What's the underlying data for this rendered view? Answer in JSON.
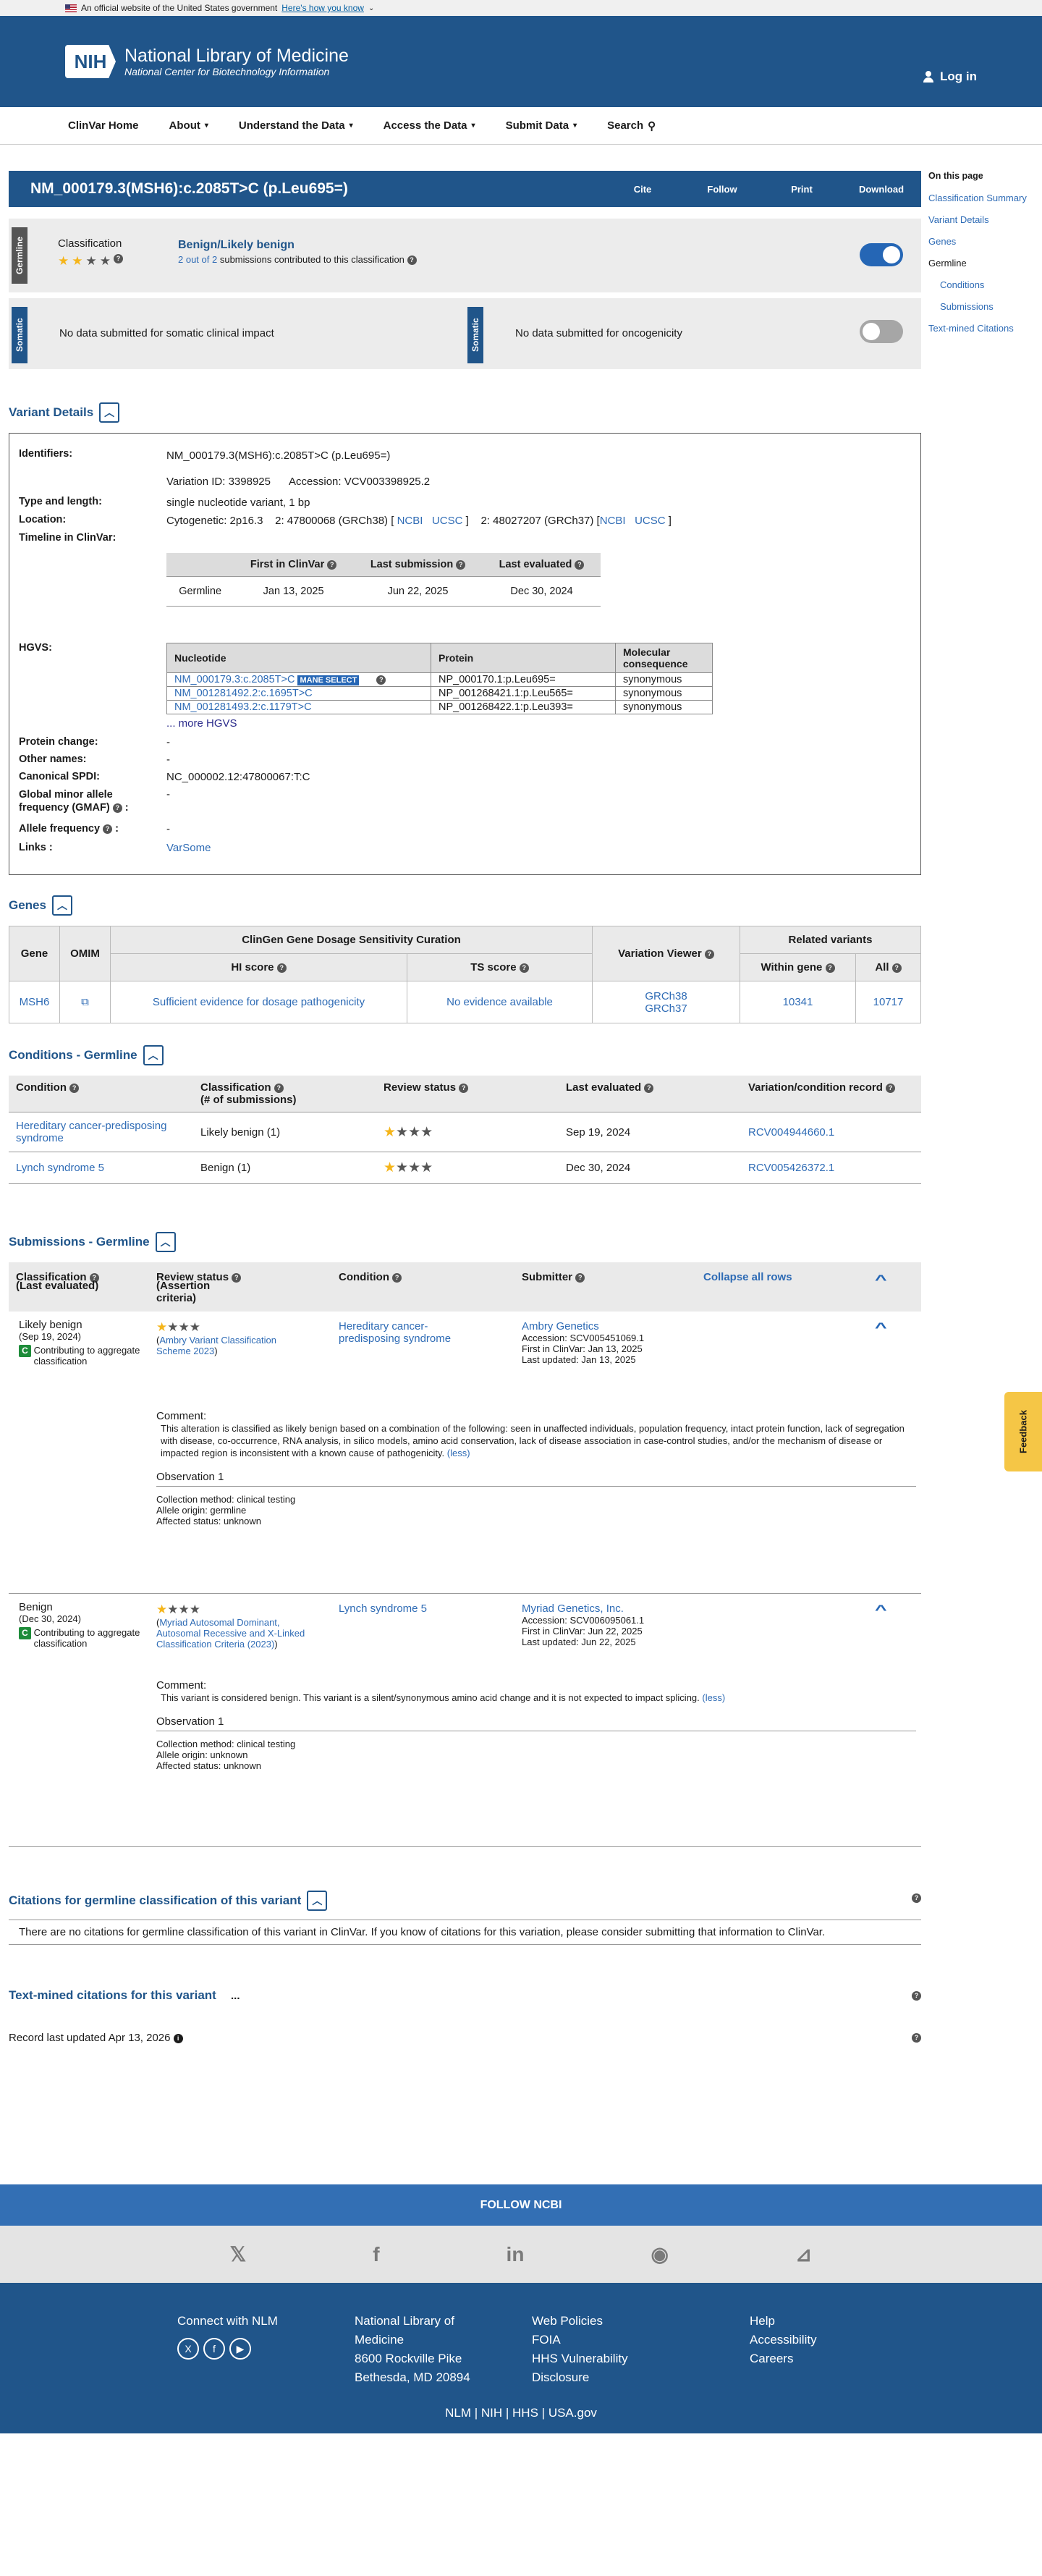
{
  "gov": {
    "text": "An official website of the United States government",
    "how": "Here's how you know"
  },
  "header": {
    "logo": "NIH",
    "title": "National Library of Medicine",
    "subtitle": "National Center for Biotechnology Information",
    "login": "Log in"
  },
  "nav": [
    "ClinVar Home",
    "About",
    "Understand the Data",
    "Access the Data",
    "Submit Data",
    "Search"
  ],
  "title_bar": {
    "title": "NM_000179.3(MSH6):c.2085T>C (p.Leu695=)",
    "cite": "Cite",
    "follow": "Follow",
    "print": "Print",
    "download": "Download"
  },
  "germline": {
    "tab": "Germline",
    "class_label": "Classification",
    "result": "Benign/Likely benign",
    "subm_count": "2 out of 2",
    "subm_rest": "submissions contributed to this classification"
  },
  "somatic": {
    "tab": "Somatic",
    "clinical": "No data submitted for somatic clinical impact",
    "onco": "No data submitted for oncogenicity"
  },
  "side": {
    "head": "On this page",
    "items": [
      "Classification Summary",
      "Variant Details",
      "Genes",
      "Germline",
      "Conditions",
      "Submissions",
      "Text-mined Citations"
    ]
  },
  "vd": {
    "head": "Variant Details",
    "labels": {
      "ident": "Identifiers:",
      "type": "Type and length:",
      "loc": "Location:",
      "timeline": "Timeline in ClinVar:",
      "hgvs": "HGVS:",
      "protein": "Protein change:",
      "other": "Other names:",
      "spdi": "Canonical SPDI:",
      "gmaf1": "Global minor allele",
      "gmaf2": "frequency (GMAF)",
      "af": "Allele frequency",
      "links": "Links :"
    },
    "ident": "NM_000179.3(MSH6):c.2085T>C (p.Leu695=)",
    "varid": "Variation ID: 3398925",
    "acc": "Accession: VCV003398925.2",
    "type": "single nucleotide variant, 1 bp",
    "cyto": "Cytogenetic: 2p16.3",
    "loc38": "2: 47800068 (GRCh38) [",
    "loc37": "2: 48027207 (GRCh37) [",
    "ncbi": "NCBI",
    "ucsc": "UCSC",
    "close": "]",
    "tl_head": [
      "First in ClinVar",
      "Last submission",
      "Last evaluated"
    ],
    "tl_row": [
      "Germline",
      "Jan 13, 2025",
      "Jun 22, 2025",
      "Dec 30, 2024"
    ],
    "hgvs_head": [
      "Nucleotide",
      "Protein",
      "Molecular consequence"
    ],
    "hgvs_rows": [
      [
        "NM_000179.3:c.2085T>C",
        "NP_000170.1:p.Leu695=",
        "synonymous"
      ],
      [
        "NM_001281492.2:c.1695T>C",
        "NP_001268421.1:p.Leu565=",
        "synonymous"
      ],
      [
        "NM_001281493.2:c.1179T>C",
        "NP_001268422.1:p.Leu393=",
        "synonymous"
      ]
    ],
    "mane": "MANE SELECT",
    "more": "... more HGVS",
    "protein": "-",
    "other": "-",
    "spdi": "NC_000002.12:47800067:T:C",
    "gmaf": "-",
    "af": "-",
    "links": "VarSome"
  },
  "genes": {
    "head": "Genes",
    "cols": [
      "Gene",
      "OMIM",
      "ClinGen Gene Dosage Sensitivity Curation",
      "HI score",
      "TS score",
      "Variation Viewer",
      "Related variants",
      "Within gene",
      "All"
    ],
    "row": {
      "gene": "MSH6",
      "hi": "Sufficient evidence for dosage pathogenicity",
      "ts": "No evidence available",
      "v1": "GRCh38",
      "v2": "GRCh37",
      "within": "10341",
      "all": "10717"
    }
  },
  "cond": {
    "head": "Conditions - Germline",
    "cols": [
      "Condition",
      "Classification",
      "(# of submissions)",
      "Review status",
      "Last evaluated",
      "Variation/condition record"
    ],
    "rows": [
      {
        "cond": "Hereditary cancer-predisposing syndrome",
        "cls": "Likely benign (1)",
        "date": "Sep 19, 2024",
        "rcv": "RCV004944660.1"
      },
      {
        "cond": "Lynch syndrome 5",
        "cls": "Benign (1)",
        "date": "Dec 30, 2024",
        "rcv": "RCV005426372.1"
      }
    ]
  },
  "subs": {
    "head": "Submissions - Germline",
    "cols": [
      "Classification",
      "(Last evaluated)",
      "Review status",
      "(Assertion criteria)",
      "Condition",
      "Submitter",
      "Collapse all rows"
    ],
    "s1": {
      "cls": "Likely benign",
      "date": "(Sep 19, 2024)",
      "contrib": "Contributing to aggregate classification",
      "crit": "Ambry Variant Classification Scheme 2023",
      "cond": "Hereditary cancer-predisposing syndrome",
      "sub": "Ambry Genetics",
      "acc": "Accession: SCV005451069.1",
      "first": "First in ClinVar: Jan 13, 2025",
      "upd": "Last updated: Jan 13, 2025",
      "comment_h": "Comment:",
      "comment": "This alteration is classified as likely benign based on a combination of the following: seen in unaffected individuals, population frequency, intact protein function, lack of segregation with disease, co-occurrence, RNA analysis, in silico models, amino acid conservation, lack of disease association in case-control studies, and/or the mechanism of disease or impacted region is inconsistent with a known cause of pathogenicity.",
      "less": "(less)",
      "obs": "Observation 1",
      "m": "Collection method: clinical testing",
      "o": "Allele origin: germline",
      "a": "Affected status: unknown"
    },
    "s2": {
      "cls": "Benign",
      "date": "(Dec 30, 2024)",
      "contrib": "Contributing to aggregate classification",
      "crit": "Myriad Autosomal Dominant, Autosomal Recessive and X-Linked Classification Criteria (2023)",
      "cond": "Lynch syndrome 5",
      "sub": "Myriad Genetics, Inc.",
      "acc": "Accession: SCV006095061.1",
      "first": "First in ClinVar: Jun 22, 2025",
      "upd": "Last updated: Jun 22, 2025",
      "comment_h": "Comment:",
      "comment": "This variant is considered benign. This variant is a silent/synonymous amino acid change and it is not expected to impact splicing.",
      "less": "(less)",
      "obs": "Observation 1",
      "m": "Collection method: clinical testing",
      "o": "Allele origin: unknown",
      "a": "Affected status: unknown"
    }
  },
  "cit": {
    "head": "Citations for germline classification of this variant",
    "text": "There are no citations for germline classification of this variant in ClinVar. If you know of citations for this variation, please consider submitting that information to ClinVar."
  },
  "tm": {
    "head": "Text-mined citations for this variant",
    "dots": "..."
  },
  "updated": "Record last updated Apr 13, 2026",
  "feedback": "Feedback",
  "footer": {
    "follow": "FOLLOW NCBI",
    "connect": "Connect with NLM",
    "addr": [
      "National Library of",
      "Medicine",
      "8600 Rockville Pike",
      "Bethesda, MD 20894"
    ],
    "col3": [
      "Web Policies",
      "FOIA",
      "HHS Vulnerability",
      "Disclosure"
    ],
    "col4": [
      "Help",
      "Accessibility",
      "Careers"
    ],
    "bottom": [
      "NLM",
      "NIH",
      "HHS",
      "USA.gov"
    ]
  }
}
